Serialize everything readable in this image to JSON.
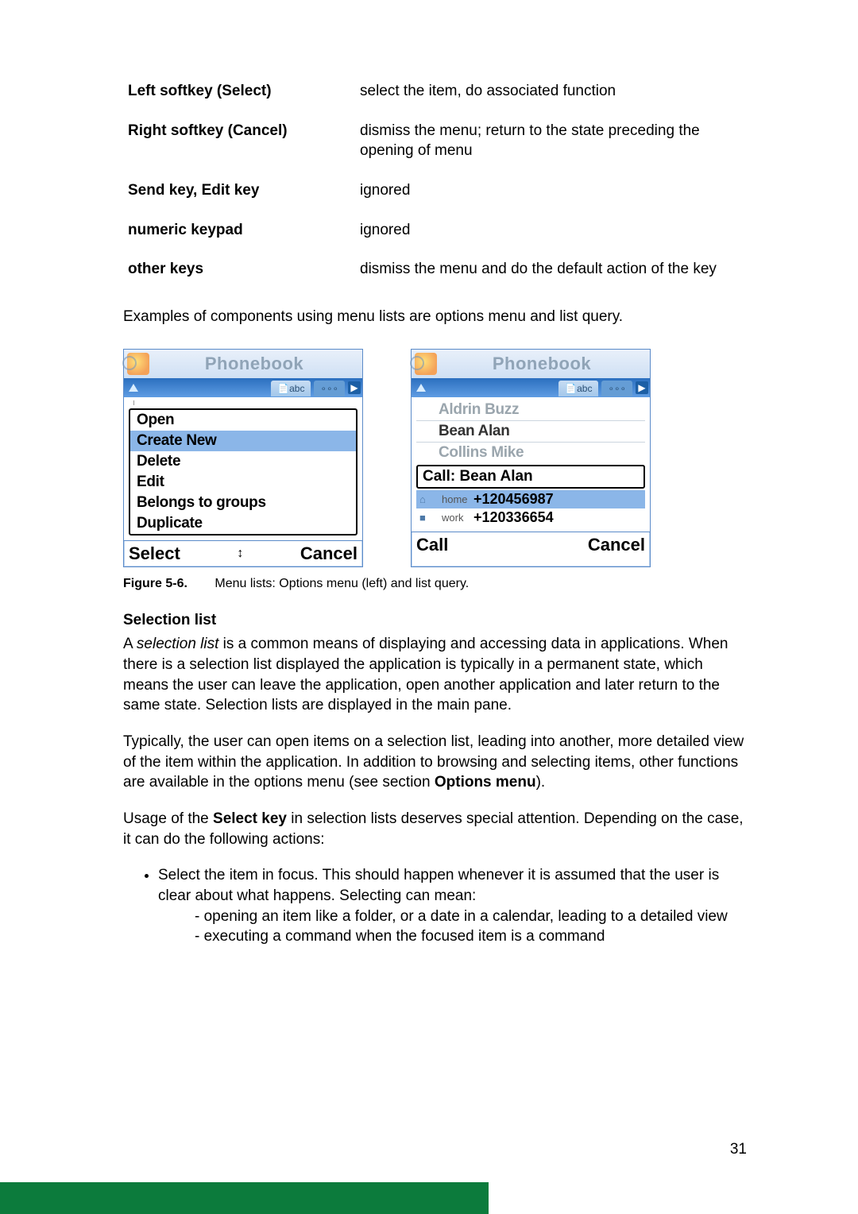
{
  "defs": [
    {
      "key": "Left softkey (Select)",
      "val": "select the item, do associated function"
    },
    {
      "key": "Right softkey (Cancel)",
      "val": "dismiss the menu; return to the state preceding the opening of menu"
    },
    {
      "key": "Send key, Edit key",
      "val": "ignored"
    },
    {
      "key": "numeric keypad",
      "val": "ignored"
    },
    {
      "key": "other keys",
      "val": "dismiss the menu and do the default action of the key"
    }
  ],
  "intro": "Examples of components using menu lists are options menu and list query.",
  "phoneA": {
    "title": "Phonebook",
    "status_tab": "abc",
    "menu": [
      "Open",
      "Create New",
      "Delete",
      "Edit",
      "Belongs to groups",
      "Duplicate"
    ],
    "selectedIndex": 1,
    "softLeft": "Select",
    "softMid": "↕",
    "softRight": "Cancel"
  },
  "phoneB": {
    "title": "Phonebook",
    "status_tab": "abc",
    "list": [
      "Aldrin Buzz",
      "Bean Alan",
      "Collins Mike"
    ],
    "activeIndex": 1,
    "callRow": "Call: Bean Alan",
    "details": [
      {
        "icon": "⌂",
        "label": "home",
        "value": "+120456987",
        "selected": true
      },
      {
        "icon": "■",
        "label": "work",
        "value": "+120336654",
        "selected": false
      }
    ],
    "softLeft": "Call",
    "softRight": "Cancel"
  },
  "figcap": {
    "num": "Figure 5-6.",
    "text": "Menu lists: Options menu (left) and list query."
  },
  "sec_heading": "Selection list",
  "para1a": "A ",
  "para1i": "selection list",
  "para1b": " is a common means of displaying and accessing data in applications. When there is a selection list displayed the application is typically in a permanent state, which means the user can leave the application, open another application and later return to the same state. Selection lists are displayed in the main pane.",
  "para2a": "Typically, the user can open items on a selection list, leading into another, more detailed view of the item within the application. In addition to browsing and selecting items, other functions are available in the options menu (see section ",
  "para2b": "Options menu",
  "para2c": ").",
  "para3a": "Usage of the ",
  "para3b": "Select key",
  "para3c": " in selection lists deserves special attention. Depending on the case, it can do the following actions:",
  "bullet1": "Select the item in focus. This should happen whenever it is assumed that the user is clear about what happens. Selecting can mean:",
  "sub1": "- opening an item like a folder, or a date in a calendar, leading to a detailed view",
  "sub2": "- executing a command when the focused item is a command",
  "pagenum": "31"
}
